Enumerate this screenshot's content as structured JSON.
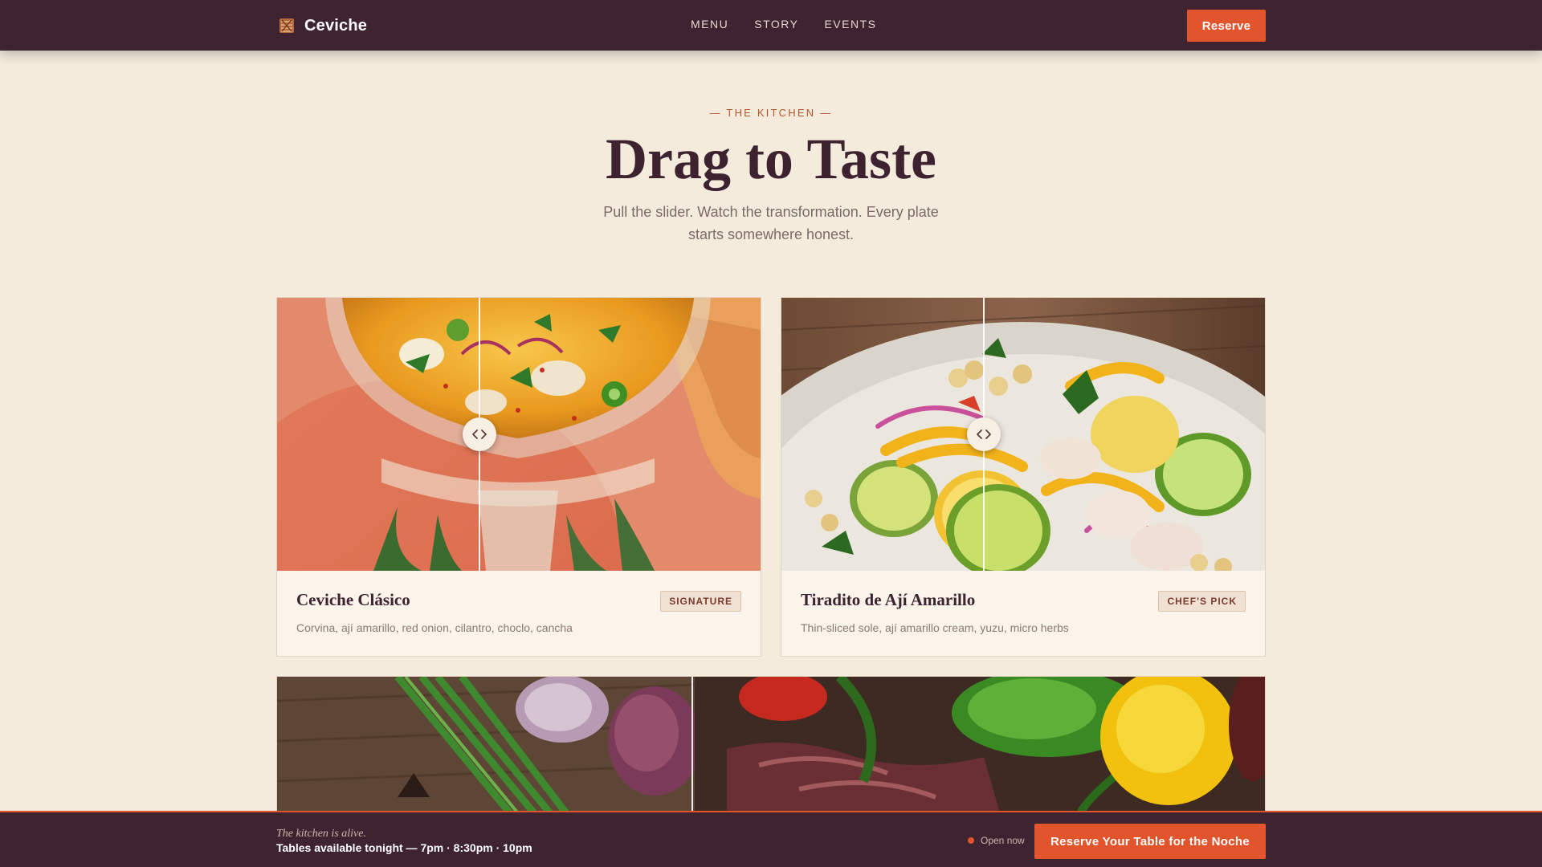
{
  "brand": {
    "name": "Ceviche",
    "icon": "ceviche-logo-icon"
  },
  "nav": {
    "links": [
      {
        "label": "MENU"
      },
      {
        "label": "STORY"
      },
      {
        "label": "EVENTS"
      }
    ],
    "reserve_label": "Reserve"
  },
  "header": {
    "eyebrow": "— THE KITCHEN —",
    "title": "Drag to Taste",
    "subtitle": "Pull the slider. Watch the transformation. Every plate starts somewhere honest."
  },
  "dishes": [
    {
      "name": "Ceviche Clásico",
      "badge": "SIGNATURE",
      "description": "Corvina, ají amarillo, red onion, cilantro, choclo, cancha",
      "slider_position": 0.42
    },
    {
      "name": "Tiradito de Ají Amarillo",
      "badge": "CHEF'S PICK",
      "description": "Thin-sliced sole, ají amarillo cream, yuzu, micro herbs",
      "slider_position": 0.42
    }
  ],
  "wide_slider": {
    "slider_position": 0.34
  },
  "bottom_bar": {
    "eyebrow": "The kitchen is alive.",
    "times": "Tables available tonight — 7pm · 8:30pm · 10pm",
    "status": "Open now",
    "cta_label": "Reserve Your Table for the Noche"
  },
  "colors": {
    "accent": "#e2552c",
    "nav_bg": "#3e2430",
    "page_bg": "#f4ebdc",
    "heading": "#3d2230"
  }
}
